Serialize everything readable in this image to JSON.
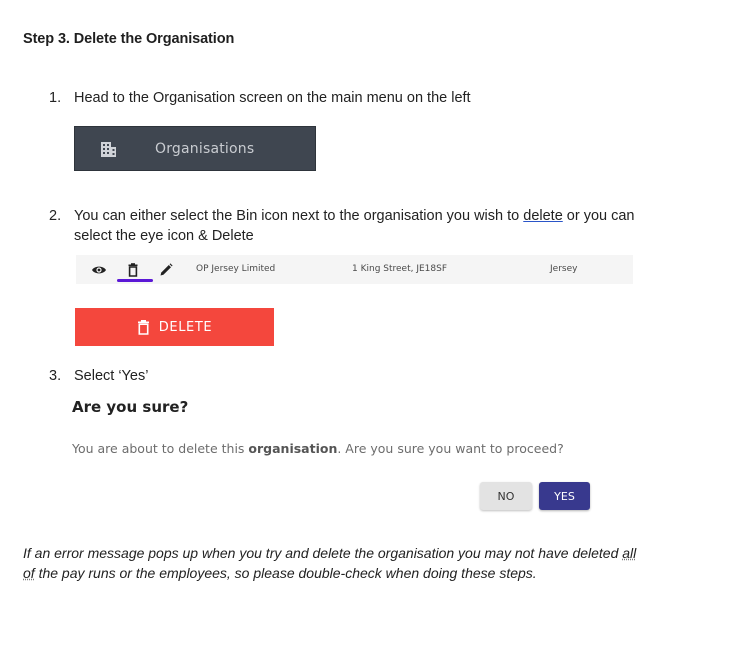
{
  "heading": "Step 3.  Delete the Organisation",
  "steps": [
    {
      "num": "1.",
      "text": "Head to the Organisation screen on the main menu on the left"
    },
    {
      "num": "2.",
      "text_a": "You can either select the Bin icon next to the organisation you wish to ",
      "text_link": "delete",
      "text_b": " or you can",
      "text_line2": "select the eye icon & Delete"
    },
    {
      "num": "3.",
      "text": "Select ‘Yes’"
    }
  ],
  "org_menu": {
    "label": "Organisations",
    "icon": "building-icon"
  },
  "table_row": {
    "name": "OP Jersey Limited",
    "address": "1 King Street, JE18SF",
    "location": "Jersey",
    "icons": [
      "eye-icon",
      "bin-icon",
      "pencil-icon"
    ]
  },
  "delete_button": {
    "label": "DELETE",
    "icon": "bin-icon",
    "color": "#f4473d"
  },
  "dialog": {
    "title": "Are you sure?",
    "message_a": "You are about to delete this ",
    "message_bold": "organisation",
    "message_b": ". Are you sure you want to proceed?",
    "no_label": "NO",
    "yes_label": "YES",
    "yes_color": "#38398e"
  },
  "note": {
    "text_a": "If an error message pops up when you try and delete the organisation you may not have deleted ",
    "text_dotted_1": "all",
    "text_dotted_2": "of",
    "text_b": " the pay runs or the employees, so please double-check when doing these steps."
  }
}
